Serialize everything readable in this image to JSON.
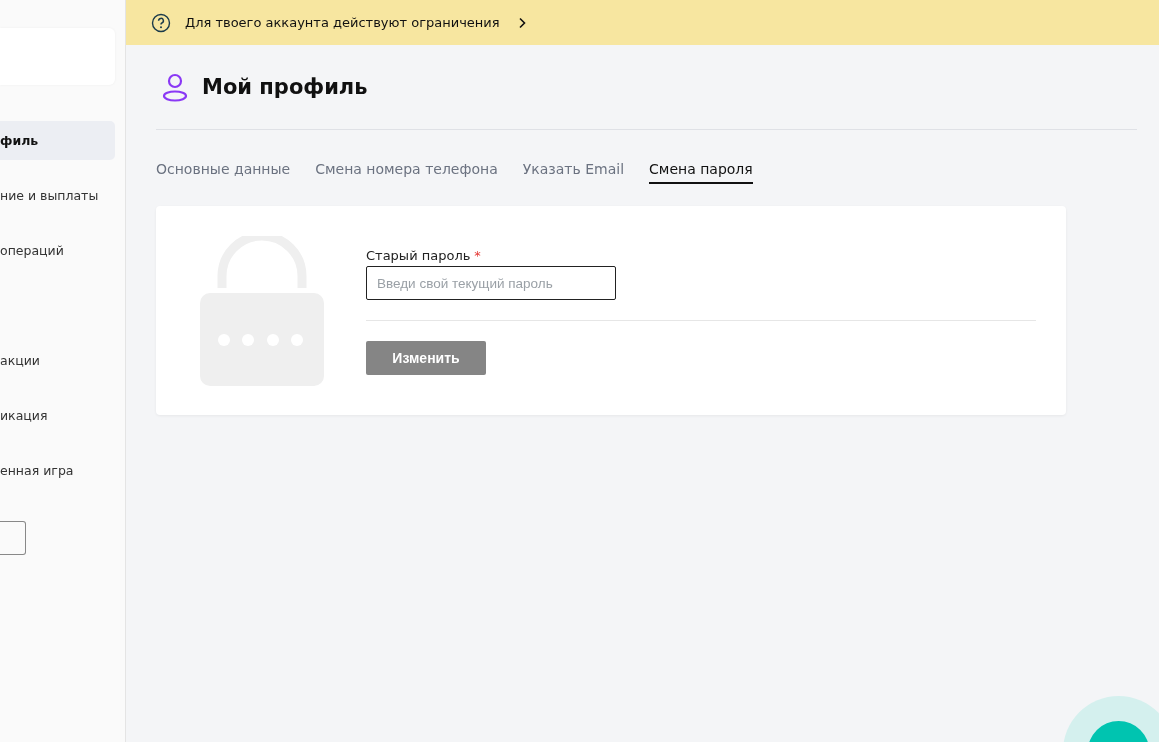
{
  "sidebar": {
    "groups": [
      [
        {
          "label": "филь",
          "selected": true
        },
        {
          "label": "ние и выплаты",
          "selected": false
        },
        {
          "label": "операций",
          "selected": false
        }
      ],
      [
        {
          "label": "акции",
          "selected": false
        },
        {
          "label": "икация",
          "selected": false
        },
        {
          "label": "енная игра",
          "selected": false
        }
      ]
    ]
  },
  "notice": {
    "text": "Для твоего аккаунта действуют ограничения"
  },
  "page_title": "Мой профиль",
  "tabs": [
    {
      "label": "Основные данные",
      "selected": false
    },
    {
      "label": "Смена номера телефона",
      "selected": false
    },
    {
      "label": "Указать Email",
      "selected": false
    },
    {
      "label": "Смена пароля",
      "selected": true
    }
  ],
  "form": {
    "field": {
      "label": "Старый пароль",
      "required_mark": "*",
      "placeholder": "Введи свой текущий пароль"
    },
    "submit": {
      "label": "Изменить",
      "disabled": true
    }
  }
}
